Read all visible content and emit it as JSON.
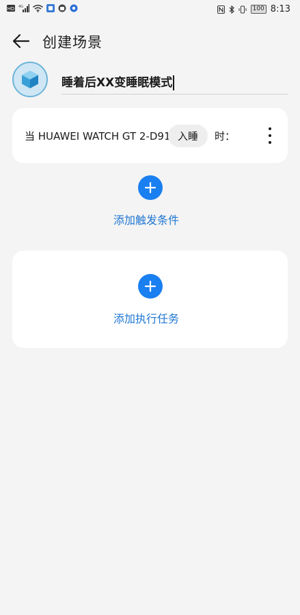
{
  "status_bar": {
    "time": "8:13",
    "battery": "100",
    "left_icons": [
      "hd-icon",
      "signal-4g-icon",
      "wifi-icon",
      "app-notification-icon",
      "android-icon",
      "browser-icon"
    ],
    "right_icons": [
      "nfc-icon",
      "bluetooth-icon",
      "vibrate-icon",
      "battery-icon"
    ]
  },
  "header": {
    "title": "创建场景",
    "back_icon": "arrow-left-icon"
  },
  "scene": {
    "icon": "cube-icon",
    "name": "睡着后XX变睡眠模式"
  },
  "condition": {
    "prefix": "当 HUAWEI WATCH GT 2-D91",
    "state": "入睡",
    "suffix": "时：",
    "more_icon": "more-vertical-icon"
  },
  "add_condition": {
    "label": "添加触发条件",
    "icon": "plus-icon"
  },
  "add_task": {
    "label": "添加执行任务",
    "icon": "plus-icon"
  },
  "colors": {
    "accent": "#1a7ff0",
    "link": "#1e76d2",
    "background": "#f4f4f4",
    "card": "#ffffff"
  }
}
